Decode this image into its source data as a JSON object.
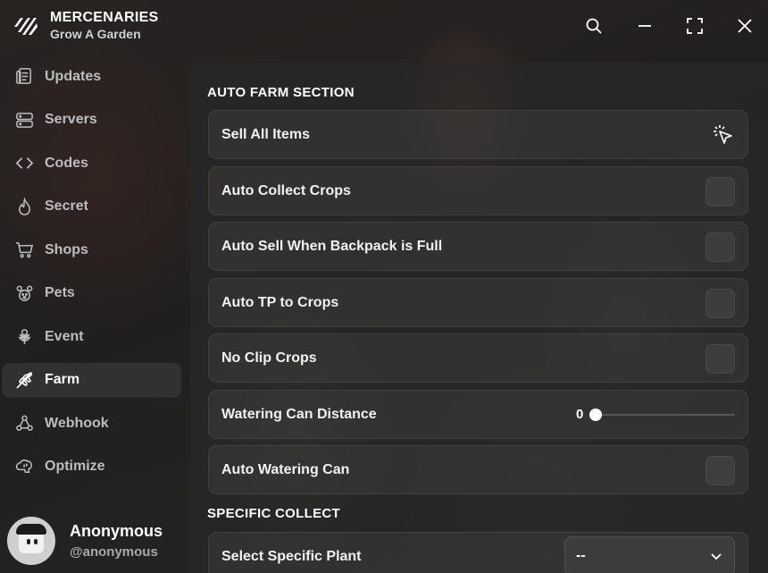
{
  "brand": {
    "title": "MERCENARIES",
    "subtitle": "Grow A Garden"
  },
  "window_controls": [
    "search-icon",
    "minimize-icon",
    "maximize-icon",
    "close-icon"
  ],
  "sidebar": {
    "items": [
      {
        "label": "Updates",
        "icon": "document-icon"
      },
      {
        "label": "Servers",
        "icon": "server-icon"
      },
      {
        "label": "Codes",
        "icon": "code-icon"
      },
      {
        "label": "Secret",
        "icon": "flame-icon"
      },
      {
        "label": "Shops",
        "icon": "cart-icon"
      },
      {
        "label": "Pets",
        "icon": "paw-icon"
      },
      {
        "label": "Event",
        "icon": "flower-icon"
      },
      {
        "label": "Farm",
        "icon": "wheat-icon",
        "active": true
      },
      {
        "label": "Webhook",
        "icon": "webhook-icon"
      },
      {
        "label": "Optimize",
        "icon": "brain-icon"
      }
    ]
  },
  "profile": {
    "name": "Anonymous",
    "handle": "@anonymous"
  },
  "main": {
    "sections": [
      {
        "title": "AUTO FARM SECTION",
        "rows": [
          {
            "label": "Sell All Items",
            "kind": "button"
          },
          {
            "label": "Auto Collect Crops",
            "kind": "toggle",
            "on": false
          },
          {
            "label": "Auto Sell When Backpack is Full",
            "kind": "toggle",
            "on": false
          },
          {
            "label": "Auto TP to Crops",
            "kind": "toggle",
            "on": false
          },
          {
            "label": "No Clip Crops",
            "kind": "toggle",
            "on": false
          },
          {
            "label": "Watering Can Distance",
            "kind": "slider",
            "value": "0",
            "fraction": 0
          },
          {
            "label": "Auto Watering Can",
            "kind": "toggle",
            "on": false
          }
        ]
      },
      {
        "title": "SPECIFIC COLLECT",
        "rows": [
          {
            "label": "Select Specific Plant",
            "kind": "dropdown",
            "selected": "--"
          }
        ]
      }
    ]
  },
  "colors": {
    "accent": "#ffffff",
    "panel": "#282828",
    "muted_text": "#bdbdbd"
  }
}
